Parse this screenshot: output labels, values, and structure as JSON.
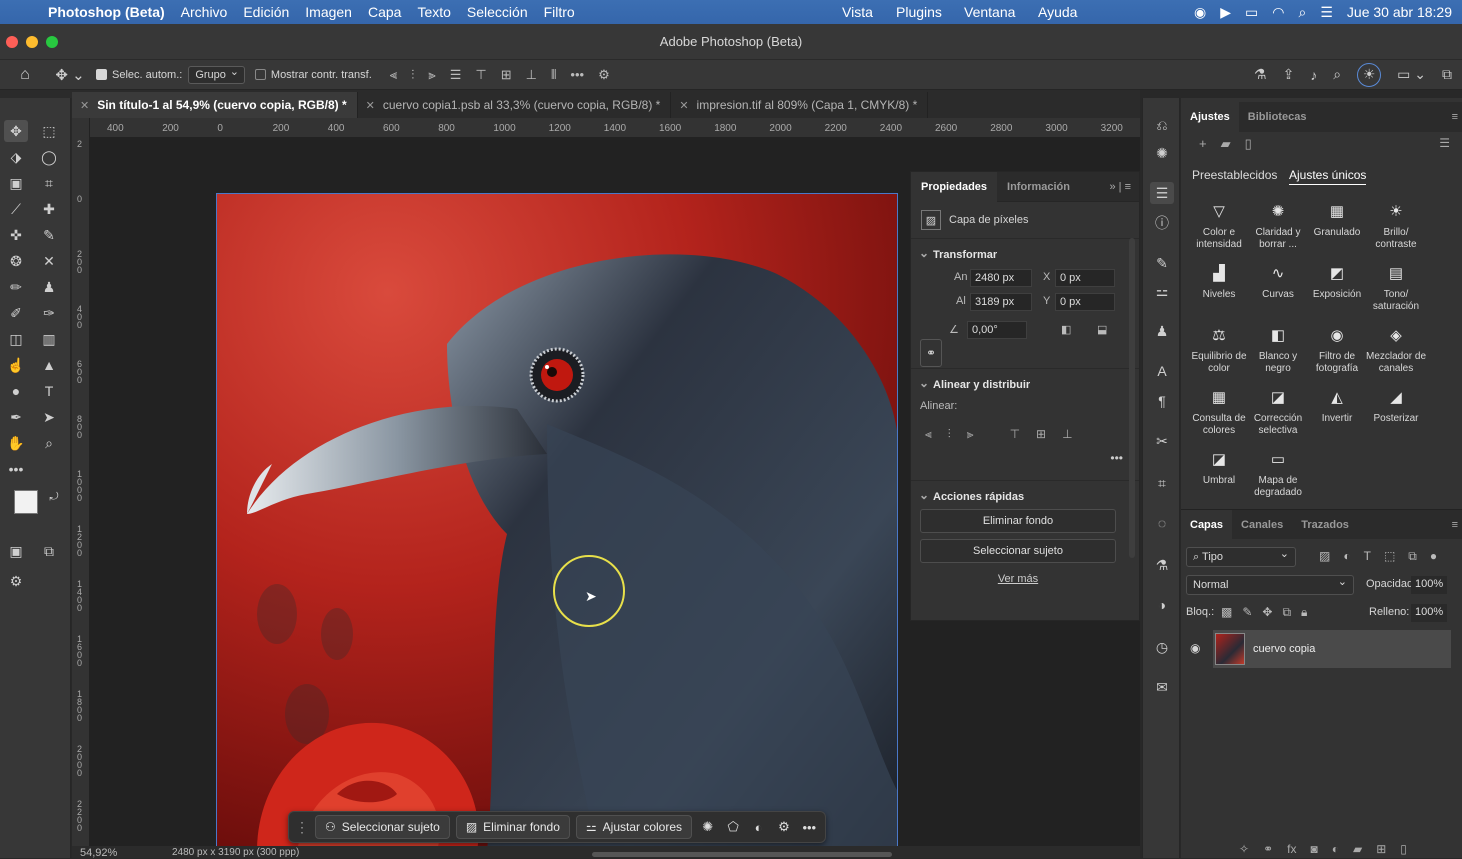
{
  "menubar": {
    "app_name": "Photoshop (Beta)",
    "items": [
      "Archivo",
      "Edición",
      "Imagen",
      "Capa",
      "Texto",
      "Selección",
      "Filtro"
    ],
    "right_items": [
      "Vista",
      "Plugins",
      "Ventana",
      "Ayuda"
    ],
    "datetime": "Jue 30 abr 18:29"
  },
  "window": {
    "title": "Adobe Photoshop (Beta)"
  },
  "options": {
    "auto_select_label": "Selec. autom.:",
    "auto_select_value": "Grupo",
    "show_transform_label": "Mostrar contr. transf."
  },
  "tabs": [
    {
      "label": "Sin título-1 al 54,9% (cuervo copia, RGB/8) *"
    },
    {
      "label": "cuervo copia1.psb al 33,3% (cuervo copia, RGB/8) *"
    },
    {
      "label": "impresion.tif al 809% (Capa 1, CMYK/8) *"
    }
  ],
  "ruler": {
    "h_ticks": [
      "400",
      "200",
      "0",
      "200",
      "400",
      "600",
      "800",
      "1000",
      "1200",
      "1400",
      "1600",
      "1800",
      "2000",
      "2200",
      "2400",
      "2600",
      "2800",
      "3000",
      "3200"
    ],
    "v_ticks": [
      "2",
      "0",
      "2 0 0",
      "4 0 0",
      "6 0 0",
      "8 0 0",
      "1 0 0 0",
      "1 2 0 0",
      "1 4 0 0",
      "1 6 0 0",
      "1 8 0 0",
      "2 0 0 0",
      "2 2 0 0"
    ]
  },
  "status": {
    "zoom": "54,92%",
    "doc_info": "2480 px x 3190 px (300 ppp)"
  },
  "context_bar": {
    "select_subject": "Seleccionar sujeto",
    "remove_bg": "Eliminar fondo",
    "adjust_colors": "Ajustar colores"
  },
  "properties": {
    "tab_active": "Propiedades",
    "tab_other": "Información",
    "layer_type": "Capa de píxeles",
    "transform_title": "Transformar",
    "width_label": "An",
    "width_value": "2480 px",
    "height_label": "Al",
    "height_value": "3189 px",
    "x_label": "X",
    "x_value": "0 px",
    "y_label": "Y",
    "y_value": "0 px",
    "angle_value": "0,00°",
    "align_title": "Alinear y distribuir",
    "align_label": "Alinear:",
    "quick_title": "Acciones rápidas",
    "quick_remove_bg": "Eliminar fondo",
    "quick_select_subject": "Seleccionar sujeto",
    "see_more": "Ver más"
  },
  "adjustments": {
    "tab_active": "Ajustes",
    "tab_other": "Bibliotecas",
    "sub_tab_presets": "Preestablecidos",
    "sub_tab_single": "Ajustes únicos",
    "items": [
      {
        "label": "Color e intensidad",
        "icon": "▽"
      },
      {
        "label": "Claridad y borrar ...",
        "icon": "✺"
      },
      {
        "label": "Granulado",
        "icon": "▦"
      },
      {
        "label": "Brillo/ contraste",
        "icon": "☀"
      },
      {
        "label": "Niveles",
        "icon": "▟"
      },
      {
        "label": "Curvas",
        "icon": "∿"
      },
      {
        "label": "Exposición",
        "icon": "◩"
      },
      {
        "label": "Tono/ saturación",
        "icon": "▤"
      },
      {
        "label": "Equilibrio de color",
        "icon": "⚖"
      },
      {
        "label": "Blanco y negro",
        "icon": "◧"
      },
      {
        "label": "Filtro de fotografía",
        "icon": "◉"
      },
      {
        "label": "Mezclador de canales",
        "icon": "◈"
      },
      {
        "label": "Consulta de colores",
        "icon": "▦"
      },
      {
        "label": "Corrección selectiva",
        "icon": "◪"
      },
      {
        "label": "Invertir",
        "icon": "◭"
      },
      {
        "label": "Posterizar",
        "icon": "◢"
      },
      {
        "label": "Umbral",
        "icon": "◪"
      },
      {
        "label": "Mapa de degradado",
        "icon": "▭"
      }
    ]
  },
  "layers": {
    "tabs": [
      "Capas",
      "Canales",
      "Trazados"
    ],
    "filter_label": "Tipo",
    "blend_mode": "Normal",
    "opacity_label": "Opacidad:",
    "opacity_value": "100%",
    "lock_label": "Bloq.:",
    "fill_label": "Relleno:",
    "fill_value": "100%",
    "layer_name": "cuervo copia"
  }
}
